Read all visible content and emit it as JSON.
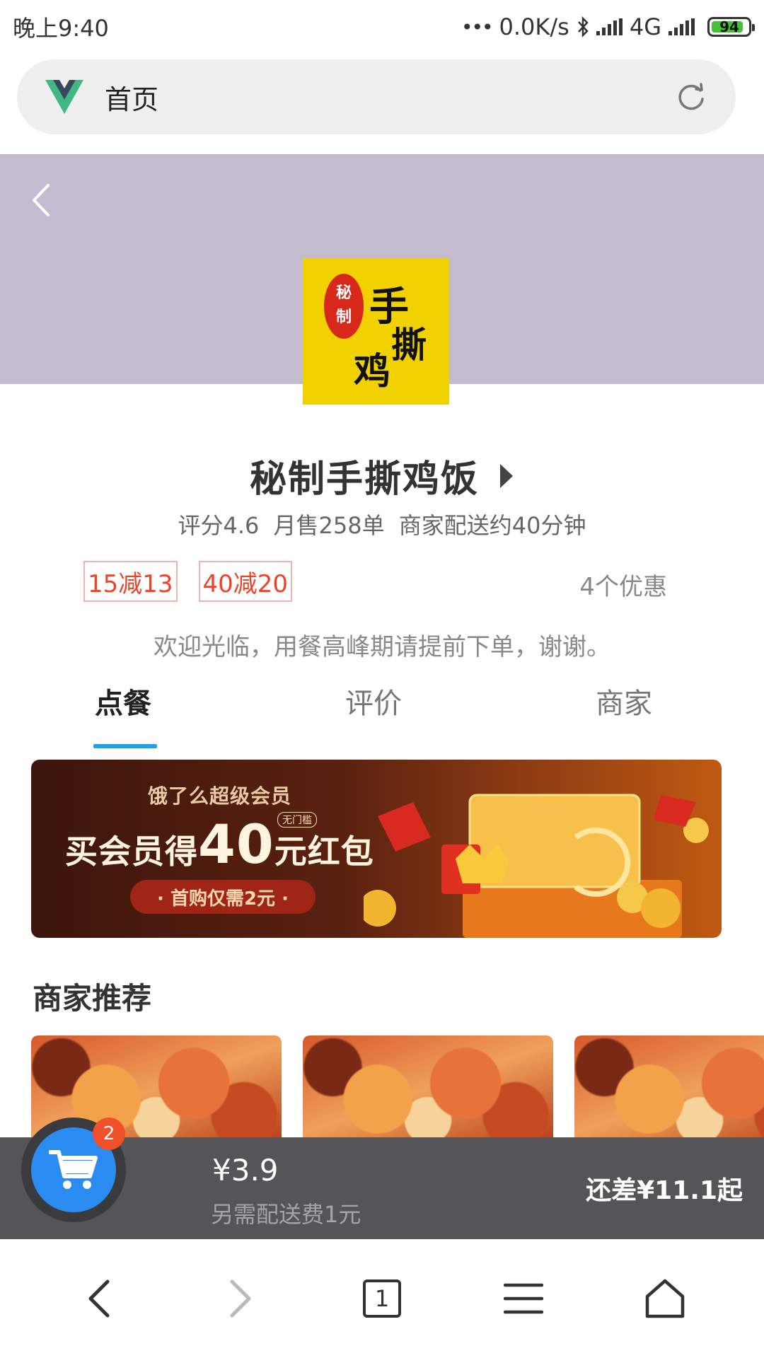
{
  "status_bar": {
    "time": "晚上9:40",
    "network_speed": "0.0K/s",
    "network_type": "4G",
    "battery": "94",
    "battery_color": "#43c239"
  },
  "address_bar": {
    "title": "首页",
    "site_icon": "vue-logo-icon",
    "reload_icon": "reload-icon"
  },
  "shop": {
    "header_color": "#c3bccf",
    "name": "秘制手撕鸡饭",
    "logo_text": {
      "seal": "秘制",
      "line1": "手",
      "line2": "撕",
      "line3": "鸡"
    },
    "meta": "评分4.6 月售258单 商家配送约40分钟",
    "promos": [
      "15减13",
      "40减20"
    ],
    "promo_count": "4个优惠",
    "notice": "欢迎光临，用餐高峰期请提前下单，谢谢。"
  },
  "tabs": [
    {
      "label": "点餐",
      "active": true
    },
    {
      "label": "评价",
      "active": false
    },
    {
      "label": "商家",
      "active": false
    }
  ],
  "accent_color": "#1ea0ea",
  "vip_banner": {
    "subtitle": "饿了么超级会员",
    "title_prefix": "买会员得",
    "title_amount": "40",
    "title_suffix": "元红包",
    "badge": "无门槛",
    "button": "· 首购仅需2元 ·"
  },
  "recommend": {
    "title": "商家推荐",
    "items": [
      {
        "image": "food-photo"
      },
      {
        "image": "food-photo"
      },
      {
        "image": "food-photo"
      }
    ]
  },
  "cart": {
    "count": "2",
    "price": "¥3.9",
    "delivery_fee": "另需配送费1元",
    "min_order": "还差¥11.1起"
  },
  "browser_nav": {
    "tab_count": "1"
  }
}
